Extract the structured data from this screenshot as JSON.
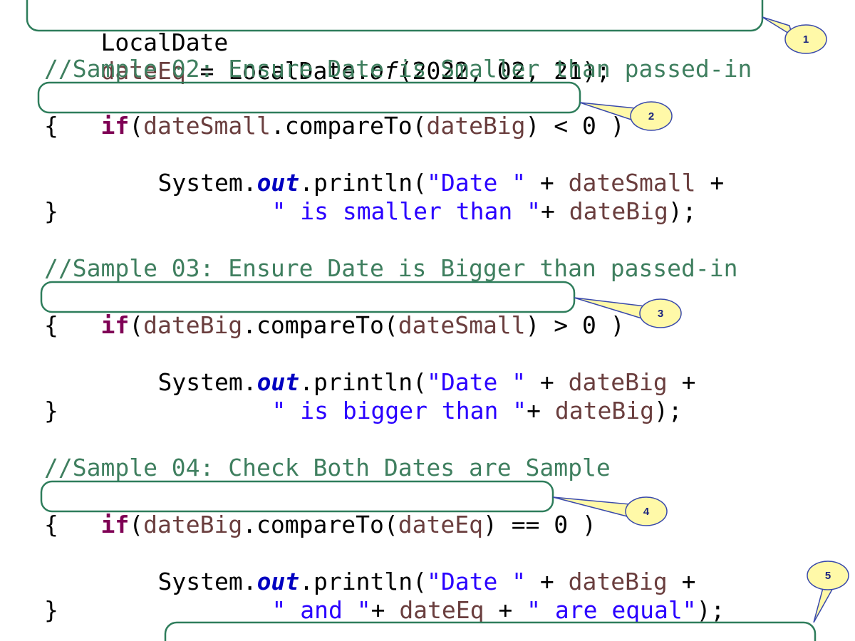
{
  "code": {
    "line_local_date": {
      "type": "LocalDate",
      "var": "dateEq",
      "assign": " = LocalDate.",
      "method": "of",
      "args": "(2022, 02, 21);"
    },
    "sample02": {
      "comment": "//Sample 02: Ensure Date is Smaller than passed-in",
      "if_keyword": "if",
      "if_open": "(",
      "if_var1": "dateSmall",
      "if_mid": ".compareTo(",
      "if_var2": "dateBig",
      "if_close": ") < 0 )",
      "open_brace": "{",
      "print_prefix": "System.",
      "print_field": "out",
      "print_call": ".println(",
      "print_str1": "\"Date \"",
      "print_plus1": " + ",
      "print_var1": "dateSmall",
      "print_plus2": " +",
      "cont_str": "\" is smaller than \"",
      "cont_plus": "+ ",
      "cont_var": "dateBig",
      "cont_end": ");",
      "close_brace": "}"
    },
    "sample03": {
      "comment": "//Sample 03: Ensure Date is Bigger than passed-in",
      "if_keyword": "if",
      "if_open": "(",
      "if_var1": "dateBig",
      "if_mid": ".compareTo(",
      "if_var2": "dateSmall",
      "if_close": ") > 0 )",
      "open_brace": "{",
      "print_prefix": "System.",
      "print_field": "out",
      "print_call": ".println(",
      "print_str1": "\"Date \"",
      "print_plus1": " + ",
      "print_var1": "dateBig",
      "print_plus2": " +",
      "cont_str": "\" is bigger than \"",
      "cont_plus": "+ ",
      "cont_var": "dateBig",
      "cont_end": ");",
      "close_brace": "}"
    },
    "sample04": {
      "comment": "//Sample 04: Check Both Dates are Sample",
      "if_keyword": "if",
      "if_open": "(",
      "if_var1": "dateBig",
      "if_mid": ".compareTo(",
      "if_var2": "dateEq",
      "if_close": ") == 0 )",
      "open_brace": "{",
      "print_prefix": "System.",
      "print_field": "out",
      "print_call": ".println(",
      "print_str1": "\"Date \"",
      "print_plus1": " + ",
      "print_var1": "dateBig",
      "print_plus2": " +",
      "cont_str1": "\" and \"",
      "cont_plus1": "+ ",
      "cont_var": "dateEq",
      "cont_plus2": " + ",
      "cont_str2": "\" are equal\"",
      "cont_end": ");",
      "close_brace": "}"
    }
  },
  "callouts": [
    "1",
    "2",
    "3",
    "4",
    "5"
  ],
  "colors": {
    "highlight_box": "#2e7d5b",
    "callout_fill": "#fff9a8",
    "callout_stroke": "#3949ab",
    "comment": "#3f7f5f",
    "keyword": "#7f0055",
    "field": "#0000c0",
    "variable": "#6a3e3e",
    "string": "#2a00ff"
  }
}
